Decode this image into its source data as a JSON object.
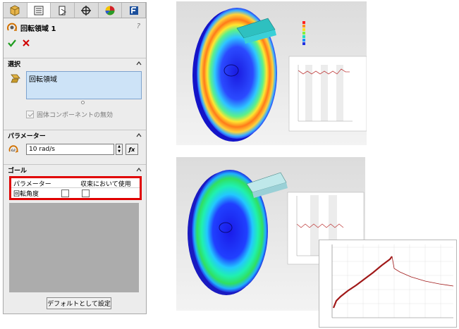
{
  "panel": {
    "tabs": [
      {
        "name": "feature-manager-tab",
        "icon": "feature-tree-icon"
      },
      {
        "name": "property-manager-tab",
        "icon": "property-list-icon"
      },
      {
        "name": "configuration-manager-tab",
        "icon": "configuration-icon"
      },
      {
        "name": "dimxpert-tab",
        "icon": "crosshair-icon"
      },
      {
        "name": "display-manager-tab",
        "icon": "appearance-icon"
      },
      {
        "name": "flow-simulation-tab",
        "icon": "flow-simulation-icon"
      }
    ],
    "title": "回転領域 1",
    "help": "?",
    "selection": {
      "header": "選択",
      "item": "回転領域",
      "disable_components_label": "固体コンポーネントの無効",
      "disable_components_checked": true
    },
    "parameters": {
      "header": "パラメーター",
      "value": "10 rad/s",
      "fx": "ƒx"
    },
    "goals": {
      "header": "ゴール",
      "col_parameter": "パラメーター",
      "col_use_in_convergence": "収束において使用",
      "rows": [
        {
          "name": "回転角度",
          "checked_a": false,
          "checked_b": false
        }
      ]
    },
    "default_button": "デフォルトとして設定"
  },
  "colors": {
    "goal_highlight": "#e00000",
    "selection_bg": "#cde3f7",
    "ok": "#1f9d1f",
    "cancel": "#d00000"
  }
}
